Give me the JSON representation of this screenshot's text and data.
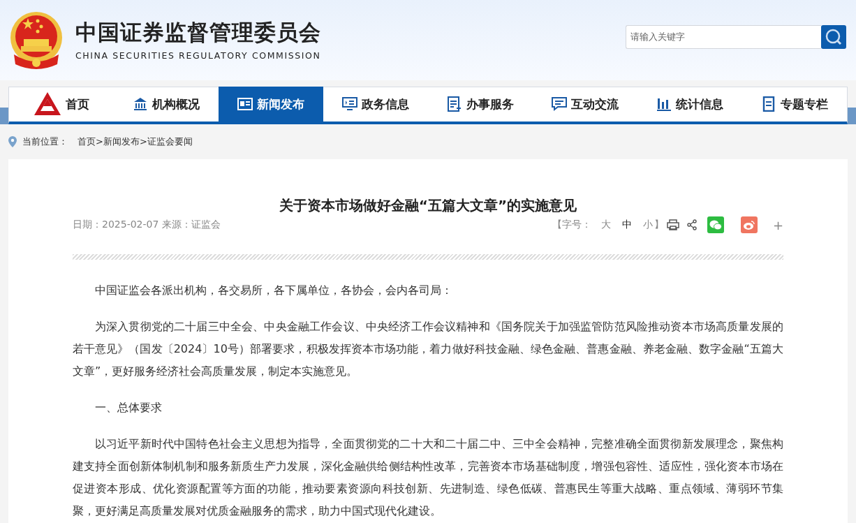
{
  "header": {
    "title": "中国证券监督管理委员会",
    "subtitle": "CHINA SECURITIES REGULATORY COMMISSION",
    "search": {
      "placeholder": "请输入关键字"
    }
  },
  "nav": [
    {
      "label": "首页",
      "kind": "logo",
      "selected": false
    },
    {
      "label": "机构概况",
      "kind": "building",
      "selected": false
    },
    {
      "label": "新闻发布",
      "kind": "news",
      "selected": true
    },
    {
      "label": "政务信息",
      "kind": "screen",
      "selected": false
    },
    {
      "label": "办事服务",
      "kind": "list",
      "selected": false
    },
    {
      "label": "互动交流",
      "kind": "chat",
      "selected": false
    },
    {
      "label": "统计信息",
      "kind": "bars",
      "selected": false
    },
    {
      "label": "专题专栏",
      "kind": "doc",
      "selected": false
    }
  ],
  "breadcrumb": {
    "label": "当前位置：",
    "path": "首页>新闻发布>证监会要闻"
  },
  "article": {
    "title": "关于资本市场做好金融“五篇大文章”的实施意见",
    "meta": "日期：2025-02-07 来源：证监会",
    "font_size": {
      "open": "【字号：",
      "close": "】",
      "options": [
        {
          "label": "大",
          "selected": false
        },
        {
          "label": "中",
          "selected": true
        },
        {
          "label": "小",
          "selected": false
        }
      ]
    },
    "more": "+",
    "paragraphs": [
      "中国证监会各派出机构，各交易所，各下属单位，各协会，会内各司局：",
      "为深入贯彻党的二十届三中全会、中央金融工作会议、中央经济工作会议精神和《国务院关于加强监管防范风险推动资本市场高质量发展的若干意见》（国发〔2024〕10号）部署要求，积极发挥资本市场功能，着力做好科技金融、绿色金融、普惠金融、养老金融、数字金融“五篇大文章”，更好服务经济社会高质量发展，制定本实施意见。",
      "一、总体要求",
      "以习近平新时代中国特色社会主义思想为指导，全面贯彻党的二十大和二十届二中、三中全会精神，完整准确全面贯彻新发展理念，聚焦构建支持全面创新体制机制和服务新质生产力发展，深化金融供给侧结构性改革，完善资本市场基础制度，增强包容性、适应性，强化资本市场在促进资本形成、优化资源配置等方面的功能，推动要素资源向科技创新、先进制造、绿色低碳、普惠民生等重大战略、重点领域、薄弱环节集聚，更好满足高质量发展对优质金融服务的需求，助力中国式现代化建设。"
    ]
  }
}
